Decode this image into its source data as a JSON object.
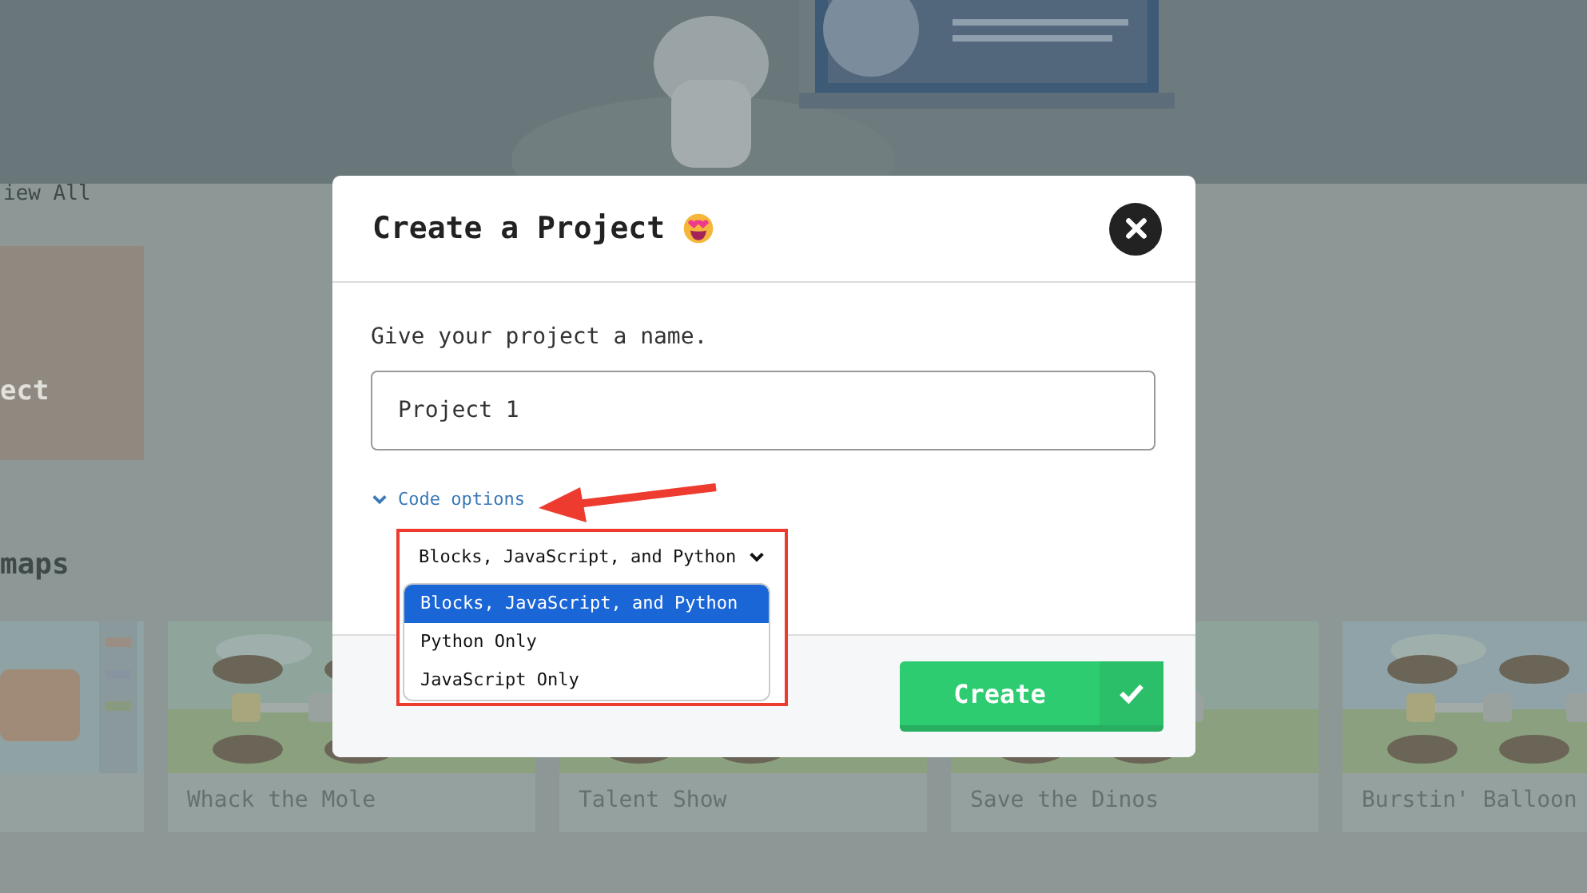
{
  "background_page": {
    "view_all_link": "iew All",
    "project_card": {
      "label": "ect"
    },
    "section_title": "maps",
    "cards": [
      {
        "title": "Whack the Mole"
      },
      {
        "title": "Talent Show"
      },
      {
        "title": "Save the Dinos"
      },
      {
        "title": "Burstin' Balloon"
      }
    ]
  },
  "dialog": {
    "title": "Create a Project",
    "prompt": "Give your project a name.",
    "name_field": {
      "value": "Project 1"
    },
    "code_options": {
      "label": "Code options",
      "expanded": true,
      "select": {
        "value": "Blocks, JavaScript, and Python",
        "open": true,
        "options": [
          {
            "label": "Blocks, JavaScript, and Python",
            "selected": true
          },
          {
            "label": "Python Only",
            "selected": false
          },
          {
            "label": "JavaScript Only",
            "selected": false
          }
        ]
      }
    },
    "create_button": "Create"
  }
}
